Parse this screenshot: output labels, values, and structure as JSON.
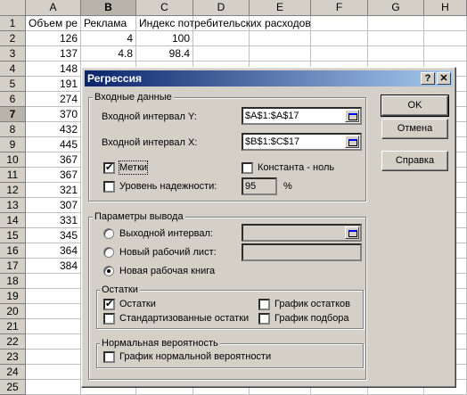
{
  "sheet": {
    "columns": [
      "A",
      "B",
      "C",
      "D",
      "E",
      "F",
      "G",
      "H"
    ],
    "rows": [
      "1",
      "2",
      "3",
      "4",
      "5",
      "6",
      "7",
      "8",
      "9",
      "10",
      "11",
      "12",
      "13",
      "14",
      "15",
      "16",
      "17",
      "18",
      "19",
      "20",
      "21",
      "22",
      "23",
      "24",
      "25"
    ],
    "row1": {
      "a": "Объем ре",
      "b": "Реклама",
      "c": "Индекс потребительских расходов"
    },
    "col_a": [
      "126",
      "137",
      "148",
      "191",
      "274",
      "370",
      "432",
      "445",
      "367",
      "367",
      "321",
      "307",
      "331",
      "345",
      "364",
      "384"
    ],
    "col_b": [
      "4",
      "4.8"
    ],
    "col_c": [
      "100",
      "98.4"
    ]
  },
  "dialog": {
    "title": "Регрессия",
    "help_btn": "?",
    "close_btn": "✕",
    "input_group": "Входные данные",
    "input_y_label": "Входной интервал Y:",
    "input_y_value": "$A$1:$A$17",
    "input_x_label": "Входной интервал X:",
    "input_x_value": "$B$1:$C$17",
    "labels_check": "Метки",
    "labels_checked": true,
    "constant_check": "Константа - ноль",
    "constant_checked": false,
    "confidence_check": "Уровень надежности:",
    "confidence_checked": false,
    "confidence_value": "95",
    "percent": "%",
    "output_group": "Параметры вывода",
    "output_range": "Выходной интервал:",
    "new_sheet": "Новый рабочий лист:",
    "new_book": "Новая рабочая книга",
    "residuals_group": "Остатки",
    "residuals": "Остатки",
    "residuals_checked": true,
    "std_residuals": "Стандартизованные остатки",
    "residual_plot": "График остатков",
    "fit_plot": "График подбора",
    "normal_group": "Нормальная вероятность",
    "normal_plot": "График нормальной вероятности",
    "ok": "OK",
    "cancel": "Отмена",
    "help": "Справка"
  }
}
